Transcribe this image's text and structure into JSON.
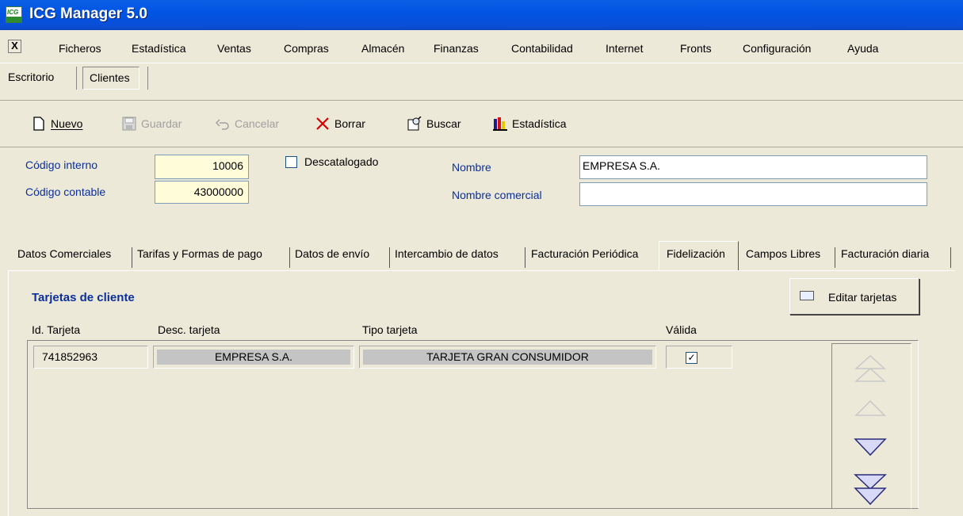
{
  "window": {
    "title": "ICG Manager 5.0",
    "logo_text": "ICG"
  },
  "menu": {
    "close_glyph": "X",
    "items": [
      "Ficheros",
      "Estadística",
      "Ventas",
      "Compras",
      "Almacén",
      "Finanzas",
      "Contabilidad",
      "Internet",
      "Fronts",
      "Configuración",
      "Ayuda"
    ]
  },
  "doc_tabs": [
    "Escritorio",
    "Clientes"
  ],
  "toolbar": {
    "nuevo": "Nuevo",
    "guardar": "Guardar",
    "cancelar": "Cancelar",
    "borrar": "Borrar",
    "buscar": "Buscar",
    "estadistica": "Estadística"
  },
  "form": {
    "codigo_interno_label": "Código interno",
    "codigo_interno": "10006",
    "codigo_contable_label": "Código contable",
    "codigo_contable": "43000000",
    "descatalogado_label": "Descatalogado",
    "nombre_label": "Nombre",
    "nombre": "EMPRESA S.A.",
    "nombre_comercial_label": "Nombre comercial",
    "nombre_comercial": ""
  },
  "tabs": [
    "Datos Comerciales",
    "Tarifas y Formas de pago",
    "Datos de envío",
    "Intercambio de datos",
    "Facturación Periódica",
    "Fidelización",
    "Campos Libres",
    "Facturación diaria"
  ],
  "active_tab": "Fidelización",
  "panel": {
    "section_title": "Tarjetas de cliente",
    "edit_button": "Editar tarjetas",
    "columns": [
      "Id. Tarjeta",
      "Desc. tarjeta",
      "Tipo tarjeta",
      "Válida"
    ],
    "rows": [
      {
        "id": "741852963",
        "desc": "EMPRESA S.A.",
        "tipo": "TARJETA GRAN CONSUMIDOR",
        "valida": true,
        "valida_glyph": "✓"
      }
    ]
  },
  "colors": {
    "titlebar": "#0054E3",
    "label_blue": "#0b2f9b",
    "field_yellow": "#FFFCDA",
    "face": "#ECE9D8"
  }
}
